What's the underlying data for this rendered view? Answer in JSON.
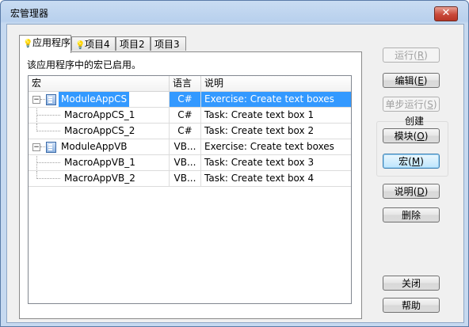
{
  "window": {
    "title": "宏管理器",
    "close_glyph": "✕"
  },
  "tabs": [
    {
      "label": "应用程序",
      "active": true,
      "icon": "bulb-icon"
    },
    {
      "label": "项目4",
      "active": false,
      "icon": "bulb-icon"
    },
    {
      "label": "项目2",
      "active": false
    },
    {
      "label": "项目3",
      "active": false
    }
  ],
  "status_text": "该应用程序中的宏已启用。",
  "table": {
    "headers": [
      "宏",
      "语言",
      "说明"
    ],
    "rows": [
      {
        "name": "ModuleAppCS",
        "lang": "C#",
        "desc": "Exercise: Create text boxes",
        "level": 0,
        "selected": true
      },
      {
        "name": "MacroAppCS_1",
        "lang": "C#",
        "desc": "Task: Create text box 1",
        "level": 1
      },
      {
        "name": "MacroAppCS_2",
        "lang": "C#",
        "desc": "Task: Create text box 2",
        "level": 1
      },
      {
        "name": "ModuleAppVB",
        "lang": "VB...",
        "desc": "Exercise: Create text boxes",
        "level": 0
      },
      {
        "name": "MacroAppVB_1",
        "lang": "VB...",
        "desc": "Task: Create text box 3",
        "level": 1
      },
      {
        "name": "MacroAppVB_2",
        "lang": "VB...",
        "desc": "Task: Create text box 4",
        "level": 1
      }
    ],
    "expander_glyph": "−"
  },
  "buttons": {
    "run": {
      "label": "运行",
      "key": "R"
    },
    "edit": {
      "label": "编辑",
      "key": "E"
    },
    "step": {
      "label": "单步运行",
      "key": "S"
    },
    "create_group": "创建",
    "module": {
      "label": "模块",
      "key": "O"
    },
    "macro": {
      "label": "宏",
      "key": "M"
    },
    "description": {
      "label": "说明",
      "key": "D"
    },
    "delete": {
      "label": "删除"
    },
    "close": {
      "label": "关闭"
    },
    "help": {
      "label": "帮助"
    }
  }
}
